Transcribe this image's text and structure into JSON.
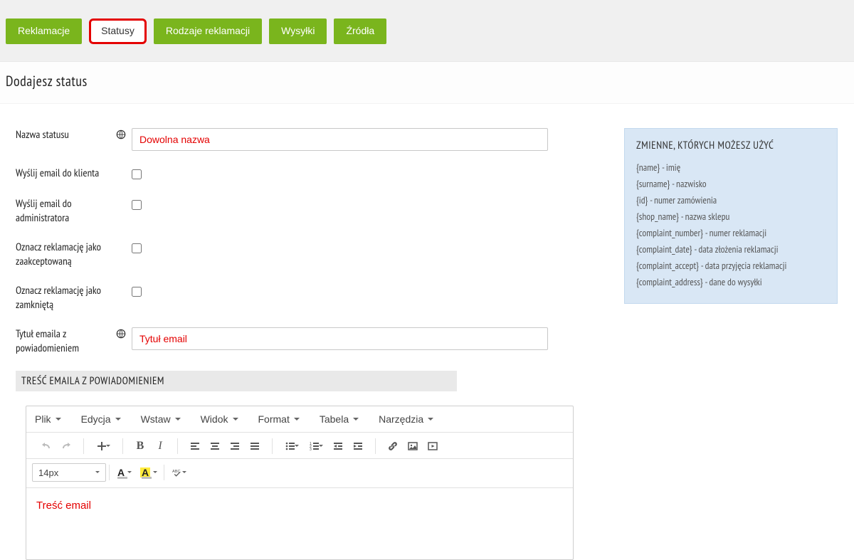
{
  "tabs": [
    {
      "label": "Reklamacje",
      "active": false
    },
    {
      "label": "Statusy",
      "active": true
    },
    {
      "label": "Rodzaje reklamacji",
      "active": false
    },
    {
      "label": "Wysyłki",
      "active": false
    },
    {
      "label": "Źródła",
      "active": false
    }
  ],
  "page_title": "Dodajesz status",
  "form": {
    "status_name": {
      "label": "Nazwa statusu",
      "value": "Dowolna nazwa",
      "has_lang": true
    },
    "email_client": {
      "label": "Wyślij email do klienta",
      "checked": false
    },
    "email_admin": {
      "label": "Wyślij email do administratora",
      "checked": false
    },
    "mark_accepted": {
      "label": "Oznacz reklamację jako zaakceptowaną",
      "checked": false
    },
    "mark_closed": {
      "label": "Oznacz reklamację jako zamkniętą",
      "checked": false
    },
    "email_title": {
      "label": "Tytuł emaila z powiadomieniem",
      "value": "Tytuł email",
      "has_lang": true
    }
  },
  "section_email_body": "TREŚĆ EMAILA Z POWIADOMIENIEM",
  "editor": {
    "menus": [
      "Plik",
      "Edycja",
      "Wstaw",
      "Widok",
      "Format",
      "Tabela",
      "Narzędzia"
    ],
    "font_size": "14px",
    "body": "Treść email"
  },
  "vars_panel": {
    "title": "ZMIENNE, KTÓRYCH MOŻESZ UŻYĆ",
    "items": [
      "{name} - imię",
      "{surname} - nazwisko",
      "{id} - numer zamówienia",
      "{shop_name} - nazwa sklepu",
      "{complaint_number} - numer reklamacji",
      "{complaint_date} - data złożenia reklamacji",
      "{complaint_accept} - data przyjęcia reklamacji",
      "{complaint_address} - dane do wysyłki"
    ]
  }
}
